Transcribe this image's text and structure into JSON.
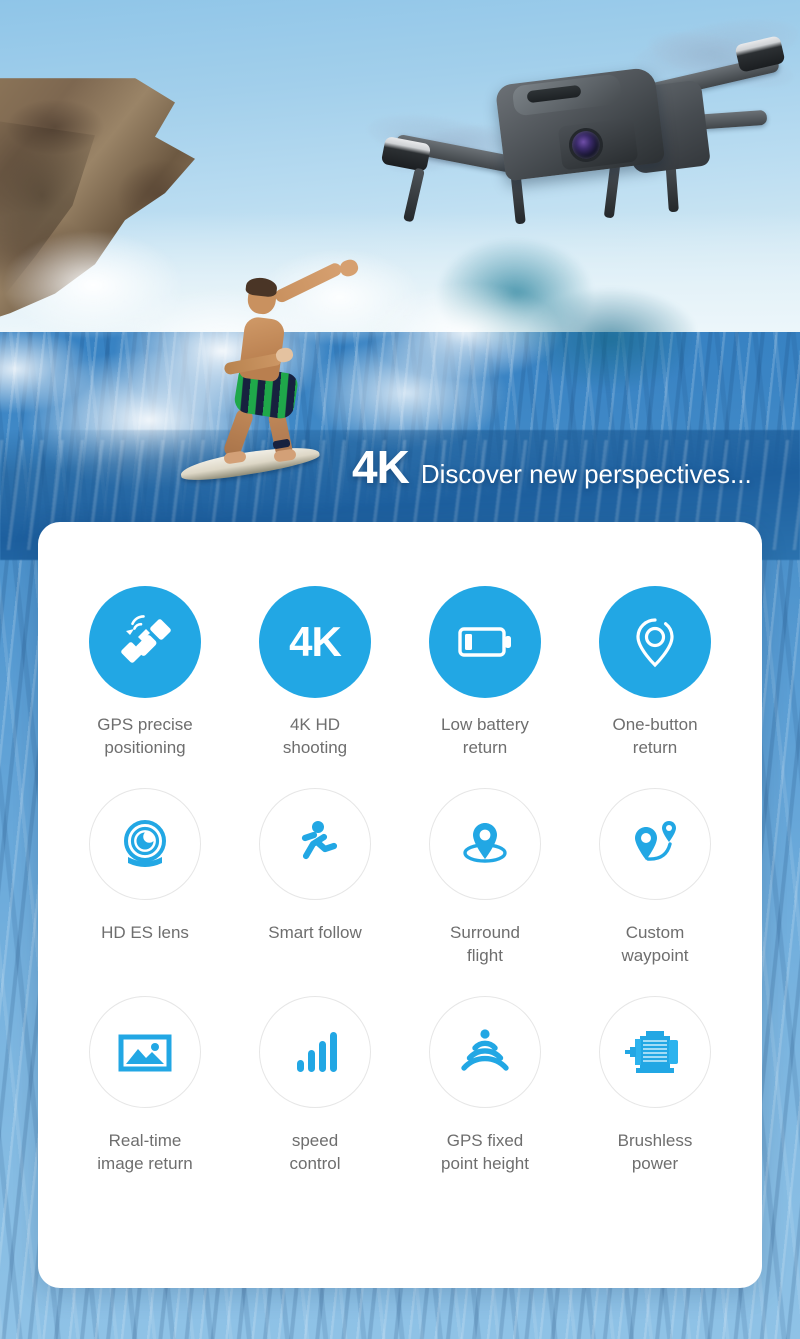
{
  "hero": {
    "tagline_badge": "4K",
    "tagline_text": "Discover new perspectives...",
    "scene_items": [
      {
        "name": "drone",
        "label": "quadcopter drone"
      },
      {
        "name": "surfer",
        "label": "surfer riding wave"
      },
      {
        "name": "ocean",
        "label": "blue ocean water"
      },
      {
        "name": "cliff",
        "label": "rocky coastal cliff"
      }
    ]
  },
  "features": {
    "rows": [
      {
        "style": "filled",
        "items": [
          {
            "icon": "satellite-icon",
            "label": "GPS precise\npositioning"
          },
          {
            "icon": "4k-text-icon",
            "label": "4K HD\nshooting",
            "text": "4K"
          },
          {
            "icon": "low-battery-icon",
            "label": "Low battery\nreturn"
          },
          {
            "icon": "location-pin-icon",
            "label": "One-button\nreturn"
          }
        ]
      },
      {
        "style": "outline",
        "items": [
          {
            "icon": "camera-lens-icon",
            "label": "HD ES lens"
          },
          {
            "icon": "running-person-icon",
            "label": "Smart follow"
          },
          {
            "icon": "orbit-pin-icon",
            "label": "Surround\nflight"
          },
          {
            "icon": "waypoint-path-icon",
            "label": "Custom\nwaypoint"
          }
        ]
      },
      {
        "style": "outline",
        "items": [
          {
            "icon": "photo-image-icon",
            "label": "Real-time\nimage return"
          },
          {
            "icon": "signal-bars-icon",
            "label": "speed\ncontrol"
          },
          {
            "icon": "sonar-waves-icon",
            "label": "GPS fixed\npoint height"
          },
          {
            "icon": "electric-motor-icon",
            "label": "Brushless\npower"
          }
        ]
      }
    ]
  },
  "colors": {
    "accent_blue": "#22a7e4",
    "card_background": "#ffffff",
    "label_text": "#6e6e6e",
    "circle_border": "#e6e6e6",
    "tagline_text": "#ffffff"
  }
}
